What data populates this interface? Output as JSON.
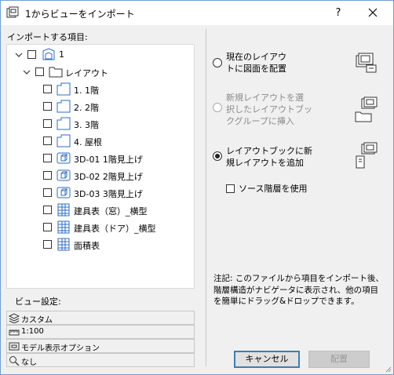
{
  "window": {
    "title": "1からビューをインポート",
    "help_label": "?"
  },
  "left": {
    "items_label": "インポートする項目:",
    "tree": {
      "root": "1",
      "layout_folder": "レイアウト",
      "items": [
        "1. 1階",
        "2. 2階",
        "3. 3階",
        "4. 屋根",
        "3D-01 1階見上げ",
        "3D-02 2階見上げ",
        "3D-03 3階見上げ",
        "建具表（窓）_横型",
        "建具表（ドア）_横型",
        "面積表"
      ]
    },
    "view_settings_label": "ビュー設定:",
    "view_settings": [
      "カスタム",
      "1:100",
      "モデル表示オプション",
      "なし"
    ]
  },
  "right": {
    "option1": [
      "現在のレイアウ",
      "トに図面を配置"
    ],
    "option2": [
      "新規レイアウトを選",
      "択したレイアウトブッ",
      "クグループに挿入"
    ],
    "option3": [
      "レイアウトブックに新",
      "規レイアウトを追加"
    ],
    "use_source_hierarchy": "ソース階層を使用",
    "note": [
      "注記: このファイルから項目をインポート後、",
      "階層構造がナビゲータに表示され、他の項目",
      "を簡単にドラッグ&ドロップできます。"
    ],
    "cancel_label": "キャンセル",
    "place_label": "配置",
    "selected_option": 3
  },
  "colors": {
    "accent": "#3c7fb1",
    "icon_blue": "#2b6cc4",
    "disabled_text": "#8a8a8a"
  },
  "icons": {
    "title": "layout-book-icon",
    "root": "project-file-icon",
    "folder": "folder-icon",
    "layout": "layout-sheet-icon",
    "view3d": "3d-view-icon",
    "schedule": "schedule-table-icon"
  }
}
